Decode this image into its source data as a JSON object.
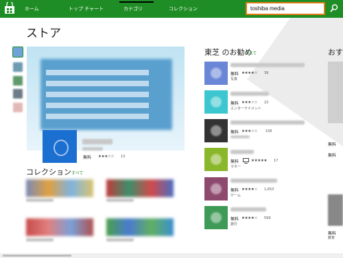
{
  "nav": {
    "items": [
      "ホーム",
      "トップ チャート",
      "カテゴリ",
      "コレクション"
    ]
  },
  "search": {
    "value": "toshiba media"
  },
  "page": {
    "title": "ストア"
  },
  "featured": {
    "price": "無料",
    "stars": "★★★☆☆",
    "count": "13"
  },
  "collection": {
    "title": "コレクション",
    "see_all": "すべて"
  },
  "toshiba": {
    "title": "東芝 のお勧め",
    "see_all": "すべて",
    "apps": [
      {
        "price": "無料",
        "stars": "★★★★☆",
        "count": "39",
        "category": "写真",
        "color": "#6a86d6"
      },
      {
        "price": "無料",
        "stars": "★★★☆☆",
        "count": "22",
        "category": "エンターテイメント",
        "color": "#3cc6cf"
      },
      {
        "price": "無料",
        "stars": "★★★☆☆",
        "count": "106",
        "category": "",
        "color": "#333333"
      },
      {
        "price": "無料",
        "stars": "★★★★★",
        "count": "17",
        "category": "マネー",
        "color": "#8ab62a"
      },
      {
        "price": "無料",
        "stars": "★★★★☆",
        "count": "1,653",
        "category": "ゲーム",
        "color": "#8e4a6e"
      },
      {
        "price": "無料",
        "stars": "★★★★☆",
        "count": "599",
        "category": "旅行",
        "color": "#3f9a57"
      }
    ]
  },
  "right_column": {
    "title": "おす",
    "price1": "無料",
    "price2": "無料",
    "price3": "無料",
    "category": "教育"
  },
  "colors": {
    "nav_bg": "#1f8d25",
    "accent": "#1f8d25",
    "search_border": "#e07b12"
  }
}
